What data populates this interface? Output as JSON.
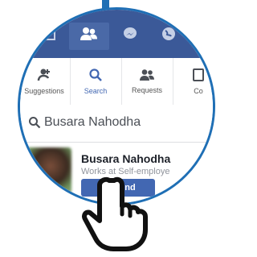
{
  "topbar": {
    "icons": [
      "feed-icon",
      "friends-icon",
      "messenger-icon",
      "globe-icon"
    ],
    "active": "friends-icon"
  },
  "tabs": [
    {
      "label": "Suggestions",
      "icon": "person-add-icon"
    },
    {
      "label": "Search",
      "icon": "search-icon",
      "active": true
    },
    {
      "label": "Requests",
      "icon": "friends-icon"
    },
    {
      "label": "Co",
      "icon": "contacts-icon"
    }
  ],
  "search": {
    "value": "Busara Nahodha"
  },
  "result": {
    "name": "Busara Nahodha",
    "subtitle": "Works at Self-employe",
    "button": "d Friend"
  },
  "colors": {
    "brand": "#3b5998",
    "accent": "#4267b2",
    "frame": "#1f6fb5"
  }
}
